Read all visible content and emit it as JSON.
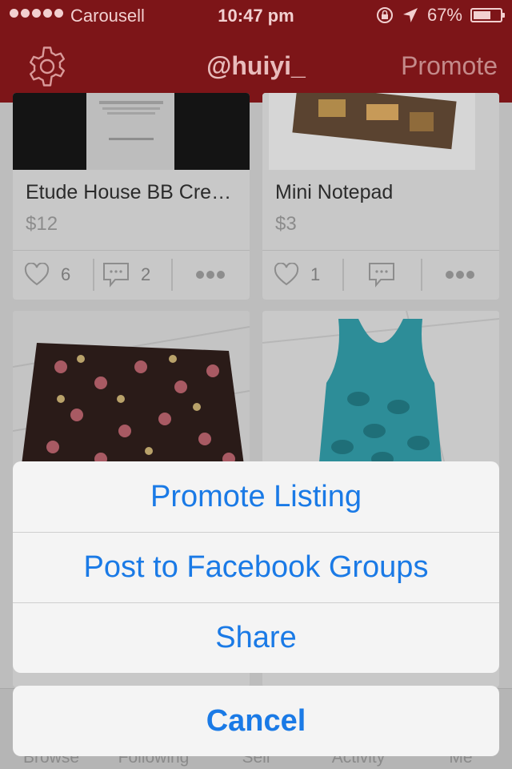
{
  "status_bar": {
    "carrier": "Carousell",
    "time": "10:47 pm",
    "battery": "67%",
    "battery_level": 0.67
  },
  "nav": {
    "title": "@huiyi_",
    "promote_label": "Promote",
    "settings_icon": "gear-icon"
  },
  "listings": [
    {
      "name": "Etude House BB Cre…",
      "price": "$12",
      "likes": "6",
      "comments": "2"
    },
    {
      "name": "Mini Notepad",
      "price": "$3",
      "likes": "1",
      "comments": ""
    }
  ],
  "action_sheet": {
    "options": [
      "Promote Listing",
      "Post to Facebook Groups",
      "Share"
    ],
    "cancel_label": "Cancel"
  },
  "tab_bar": {
    "tabs": [
      "Browse",
      "Following",
      "Sell",
      "Activity",
      "Me"
    ]
  },
  "colors": {
    "brand_red": "#7d1518",
    "ios_blue": "#1a7ae6"
  }
}
